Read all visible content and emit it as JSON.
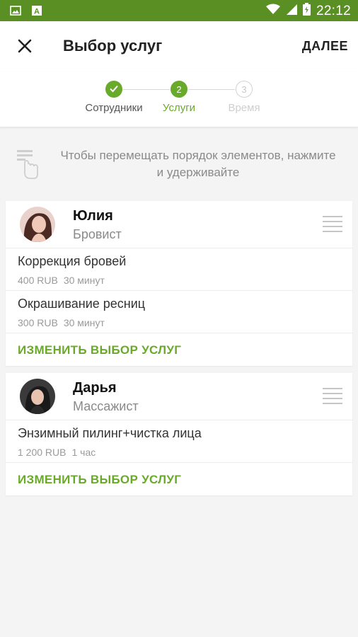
{
  "status_bar": {
    "time": "22:12"
  },
  "toolbar": {
    "title": "Выбор услуг",
    "next_label": "ДАЛЕЕ"
  },
  "stepper": {
    "steps": [
      {
        "label": "Сотрудники",
        "number": "1",
        "state": "done"
      },
      {
        "label": "Услуги",
        "number": "2",
        "state": "active"
      },
      {
        "label": "Время",
        "number": "3",
        "state": "inactive"
      }
    ]
  },
  "hint": {
    "text": "Чтобы перемещать порядок элементов, нажмите и удерживайте"
  },
  "employees": [
    {
      "name": "Юлия",
      "role": "Бровист",
      "services": [
        {
          "name": "Коррекция бровей",
          "price": "400 RUB",
          "duration": "30 минут"
        },
        {
          "name": "Окрашивание ресниц",
          "price": "300 RUB",
          "duration": "30 минут"
        }
      ],
      "change_label": "ИЗМЕНИТЬ ВЫБОР УСЛУГ"
    },
    {
      "name": "Дарья",
      "role": "Массажист",
      "services": [
        {
          "name": "Энзимный пилинг+чистка лица",
          "price": "1 200 RUB",
          "duration": "1 час"
        }
      ],
      "change_label": "ИЗМЕНИТЬ ВЫБОР УСЛУГ"
    }
  ],
  "colors": {
    "accent": "#6aaa2a",
    "statusbar": "#5a8f24"
  }
}
